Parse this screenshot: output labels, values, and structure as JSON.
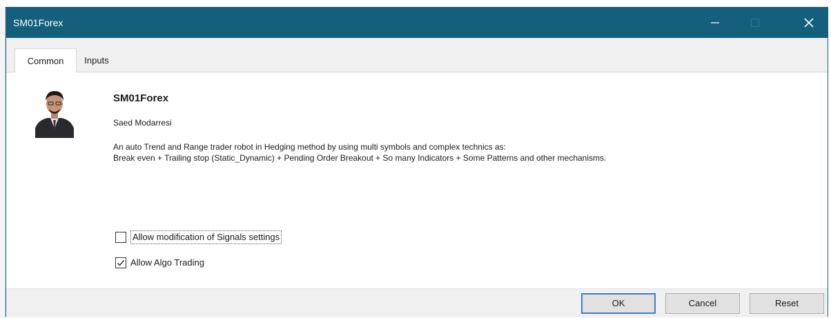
{
  "window": {
    "title": "SM01Forex",
    "icons": {
      "minimize": "minimize-icon",
      "maximize": "maximize-icon",
      "close": "close-icon"
    },
    "colors": {
      "titlebar": "#135f7c",
      "title_text": "#ffffff"
    }
  },
  "tabs": [
    {
      "label": "Common",
      "active": true
    },
    {
      "label": "Inputs",
      "active": false
    }
  ],
  "expert": {
    "name": "SM01Forex",
    "author": "Saed Modarresi",
    "description_line1": "An auto Trend and Range trader robot in Hedging method by using multi symbols and complex technics as:",
    "description_line2": "Break even + Trailing stop (Static_Dynamic) + Pending Order Breakout + So many Indicators + Some Patterns and other mechanisms."
  },
  "options": {
    "allow_signals": {
      "label": "Allow modification of Signals settings",
      "checked": false
    },
    "allow_algo": {
      "label": "Allow Algo Trading",
      "checked": true
    }
  },
  "buttons": {
    "ok": "OK",
    "cancel": "Cancel",
    "reset": "Reset"
  }
}
